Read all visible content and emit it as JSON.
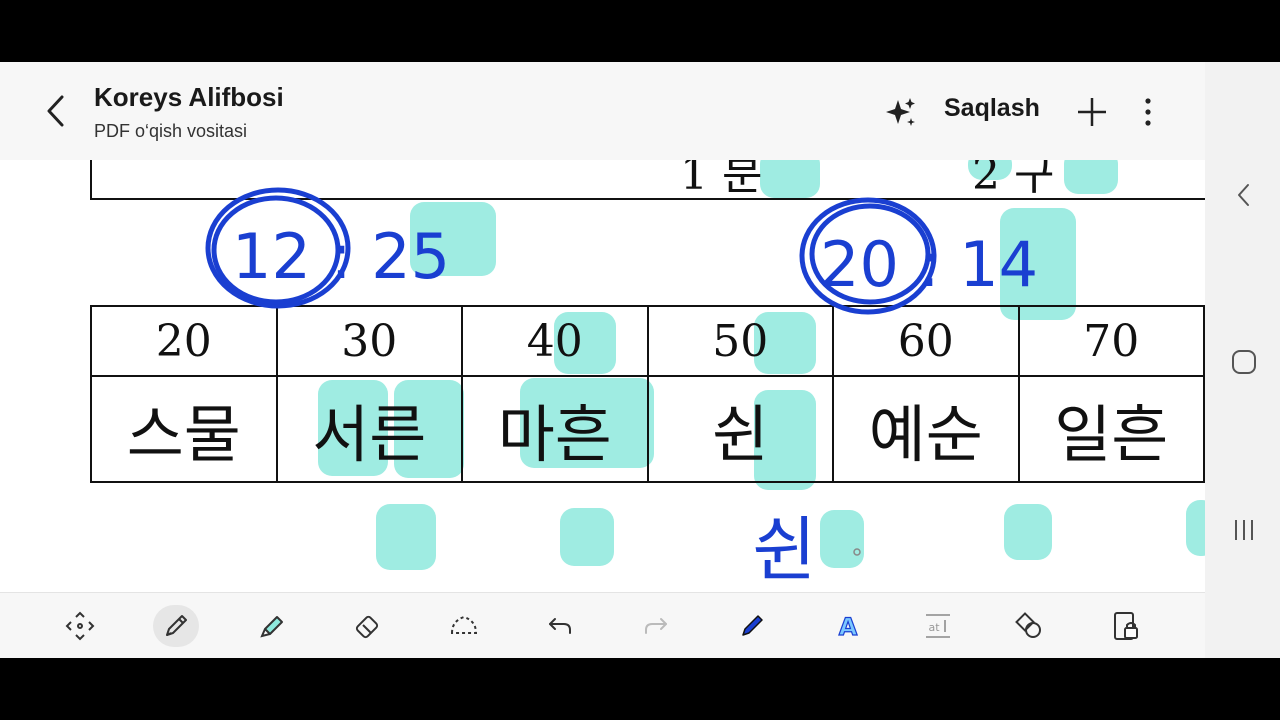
{
  "header": {
    "title": "Koreys Alifbosi",
    "subtitle": "PDF o‘qish vositasi",
    "save_label": "Saqlash",
    "back_icon": "back-arrow-icon",
    "ai_icon": "sparkle-ai-icon",
    "add_icon": "plus-icon",
    "more_icon": "more-vertical-icon"
  },
  "document": {
    "top_row_partial": [
      "1 분",
      "2 구"
    ],
    "numbers": [
      "20",
      "30",
      "40",
      "50",
      "60",
      "70"
    ],
    "words": [
      "스물",
      "서른",
      "마흔",
      "쉰",
      "예순",
      "일흔"
    ]
  },
  "handwriting": {
    "annotation1": "12 : 25",
    "annotation2": "20 : 14",
    "below_text": "쉰",
    "ink_color": "#1a3fd1",
    "highlight_color": "#8ee9dd"
  },
  "toolbar": {
    "tools": [
      "selection-icon",
      "pen-icon",
      "highlighter-icon",
      "eraser-icon",
      "lasso-icon",
      "undo-icon",
      "redo-icon",
      "pen-color-icon",
      "text-style-icon",
      "text-box-icon",
      "shapes-icon",
      "lock-icon"
    ]
  },
  "navbar": {
    "icons": [
      "nav-back-icon",
      "nav-home-icon",
      "nav-recents-icon"
    ]
  }
}
